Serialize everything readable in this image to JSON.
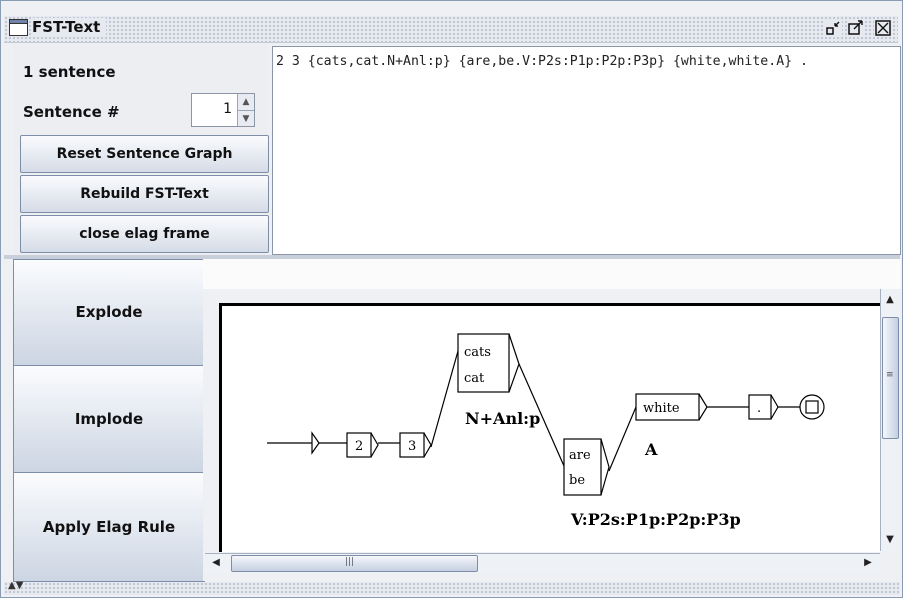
{
  "window": {
    "title": "FST-Text",
    "buttons": {
      "iconify_icon": "iconify-icon",
      "maximize_icon": "maximize-icon",
      "close_icon": "close-icon"
    }
  },
  "info": {
    "sentence_count": "1 sentence",
    "sentence_label": "Sentence #",
    "sentence_value": "1"
  },
  "buttons": {
    "reset": "Reset Sentence Graph",
    "rebuild": "Rebuild FST-Text",
    "close_elag": "close elag frame",
    "explode": "Explode",
    "implode": "Implode",
    "apply_elag": "Apply Elag Rule"
  },
  "text_area": {
    "content": "2 3 {cats,cat.N+Anl:p} {are,be.V:P2s:P1p:P2p:P3p} {white,white.A} ."
  },
  "graph": {
    "boxes": [
      {
        "id": "b2",
        "lines": [
          "2"
        ]
      },
      {
        "id": "b3",
        "lines": [
          "3"
        ]
      },
      {
        "id": "bcats",
        "lines": [
          "cats",
          "cat"
        ],
        "output": "N+Anl:p"
      },
      {
        "id": "bare",
        "lines": [
          "are",
          "be"
        ],
        "output": "V:P2s:P1p:P2p:P3p"
      },
      {
        "id": "bwhite",
        "lines": [
          "white"
        ],
        "output": "A"
      },
      {
        "id": "bdot",
        "lines": [
          "."
        ]
      }
    ]
  },
  "colors": {
    "button_border": "#7f8ea8",
    "frame_border": "#8a9bb4",
    "graph_line": "#000000"
  }
}
